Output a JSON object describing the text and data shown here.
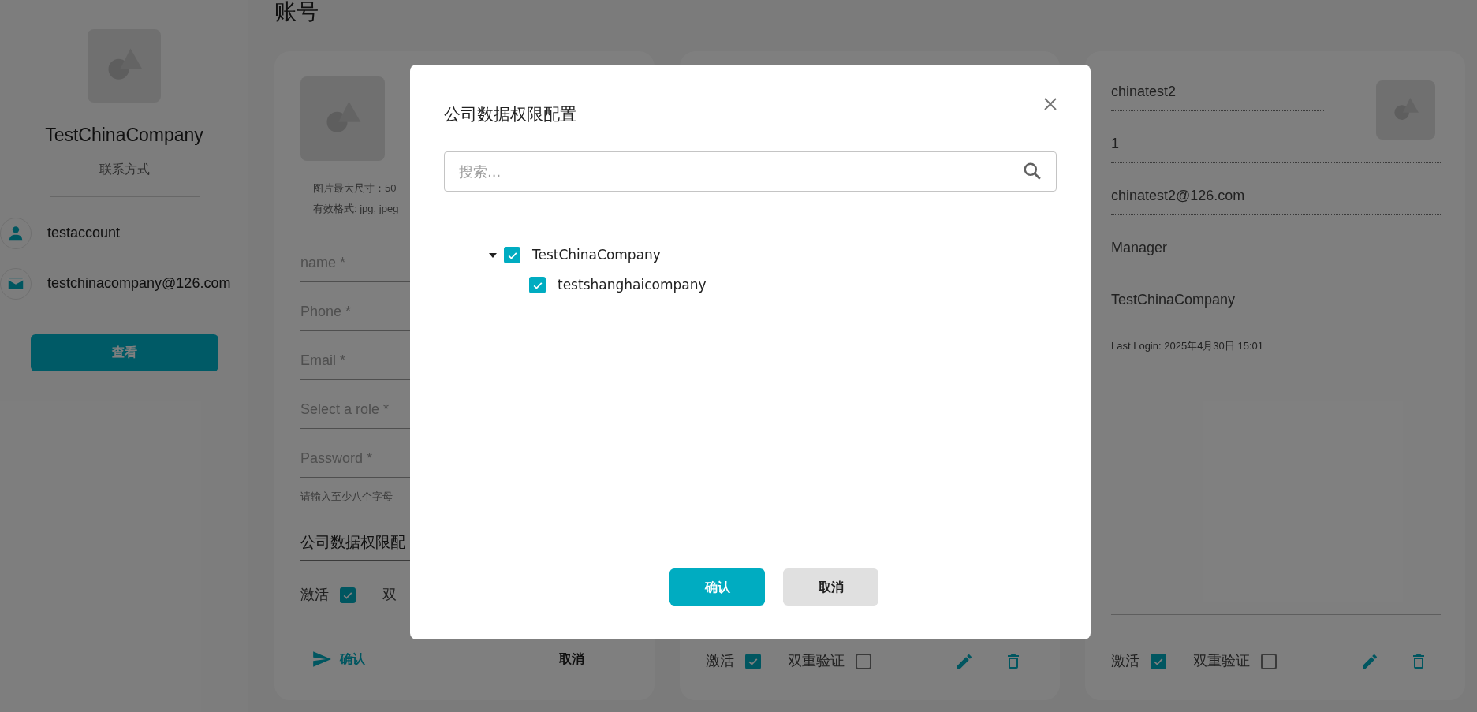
{
  "page_title": "账号",
  "sidebar": {
    "company_name": "TestChinaCompany",
    "subtitle": "联系方式",
    "contacts": [
      {
        "kind": "user",
        "text": "testaccount"
      },
      {
        "kind": "email",
        "text": "testchinacompany@126.com"
      }
    ],
    "button": "查看"
  },
  "cards": [
    {
      "kind": "form",
      "image_hints": [
        "图片最大尺寸：50",
        "有效格式: jpg, jpeg"
      ],
      "fields": [
        {
          "placeholder": "name *"
        },
        {
          "placeholder": "Phone *"
        },
        {
          "placeholder": "Email *"
        },
        {
          "placeholder": "Select a role *"
        },
        {
          "placeholder": "Password *"
        }
      ],
      "password_hint": "请输入至少八个字母",
      "permission_field": "公司数据权限配",
      "toggles": [
        {
          "label": "激活",
          "checked": true
        },
        {
          "label": "双"
        }
      ],
      "actions": [
        {
          "kind": "submit",
          "label": "确认"
        },
        {
          "kind": "cancel",
          "label": "取消"
        }
      ]
    },
    {
      "kind": "view",
      "toggles": [
        {
          "label": "激活",
          "checked": true
        },
        {
          "label": "双重验证",
          "checked": false
        }
      ]
    },
    {
      "kind": "view",
      "values": [
        "chinatest2",
        "1",
        "chinatest2@126.com",
        "Manager",
        "TestChinaCompany"
      ],
      "last_login": "Last Login: 2025年4月30日 15:01",
      "toggles": [
        {
          "label": "激活",
          "checked": true
        },
        {
          "label": "双重验证",
          "checked": false
        }
      ]
    }
  ],
  "dialog": {
    "title": "公司数据权限配置",
    "search_placeholder": "搜索...",
    "tree": [
      {
        "label": "TestChinaCompany",
        "checked": true,
        "expanded": true,
        "children": [
          {
            "label": "testshanghaicompany",
            "checked": true
          }
        ]
      }
    ],
    "buttons": [
      {
        "kind": "primary",
        "label": "确认"
      },
      {
        "kind": "secondary",
        "label": "取消"
      }
    ]
  }
}
